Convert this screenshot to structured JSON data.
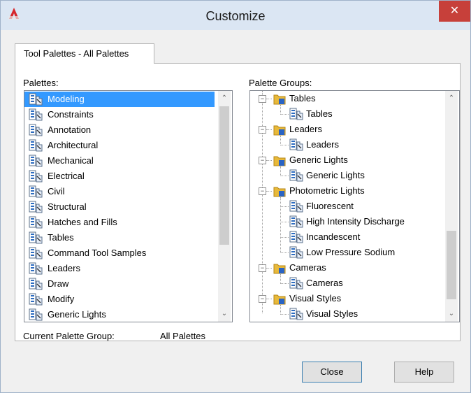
{
  "window": {
    "title": "Customize",
    "close_glyph": "✕"
  },
  "tab": {
    "label": "Tool Palettes - All Palettes"
  },
  "palettes": {
    "label": "Palettes:",
    "items": [
      "Modeling",
      "Constraints",
      "Annotation",
      "Architectural",
      "Mechanical",
      "Electrical",
      "Civil",
      "Structural",
      "Hatches and Fills",
      "Tables",
      "Command Tool Samples",
      "Leaders",
      "Draw",
      "Modify",
      "Generic Lights"
    ],
    "selected": "Modeling"
  },
  "groups": {
    "label": "Palette Groups:",
    "tree": [
      {
        "name": "Tables",
        "children": [
          "Tables"
        ]
      },
      {
        "name": "Leaders",
        "children": [
          "Leaders"
        ]
      },
      {
        "name": "Generic Lights",
        "children": [
          "Generic Lights"
        ]
      },
      {
        "name": "Photometric Lights",
        "children": [
          "Fluorescent",
          "High Intensity Discharge",
          "Incandescent",
          "Low Pressure Sodium"
        ]
      },
      {
        "name": "Cameras",
        "children": [
          "Cameras"
        ]
      },
      {
        "name": "Visual Styles",
        "children": [
          "Visual Styles"
        ]
      }
    ]
  },
  "current_group": {
    "label": "Current Palette Group:",
    "value": "All Palettes"
  },
  "buttons": {
    "close": "Close",
    "help": "Help"
  },
  "scroll_glyphs": {
    "up": "⌃",
    "down": "⌄"
  }
}
